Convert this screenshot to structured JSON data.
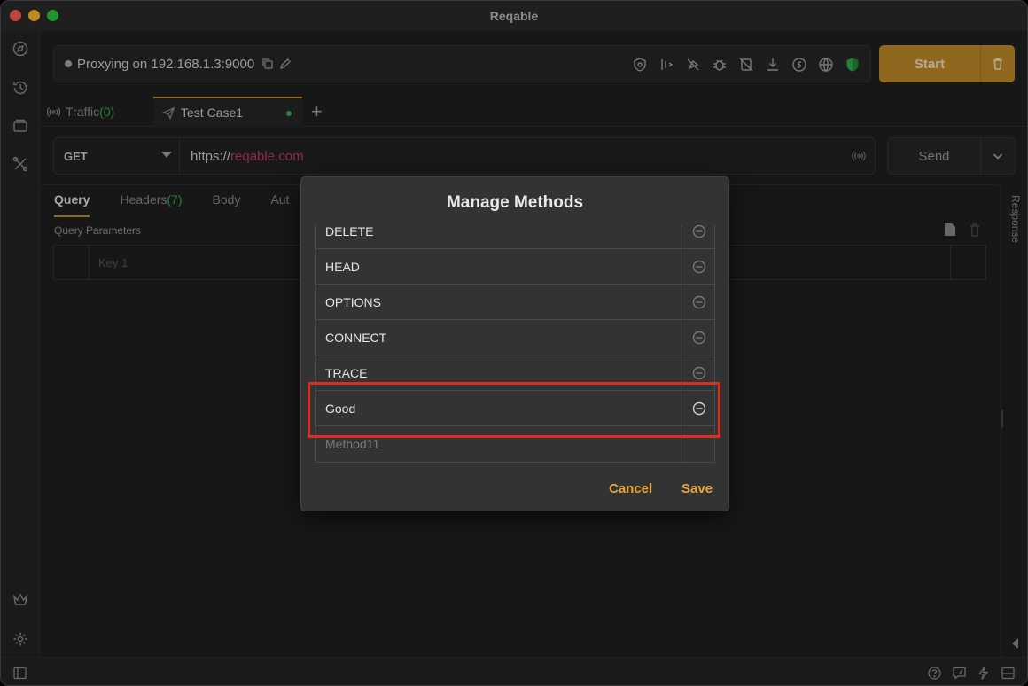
{
  "window": {
    "title": "Reqable"
  },
  "proxy": {
    "status_text": "Proxying on 192.168.1.3:9000"
  },
  "toolbar": {
    "start_label": "Start",
    "tools": [
      "ssl-icon",
      "throttle-icon",
      "breakpoint-off-icon",
      "debug-icon",
      "rewrite-off-icon",
      "download-icon",
      "script-icon",
      "network-icon",
      "shield-icon"
    ]
  },
  "tabs": [
    {
      "label": "Traffic",
      "count": "(0)"
    },
    {
      "label": "Test Case1"
    }
  ],
  "request": {
    "method": "GET",
    "url_scheme": "https://",
    "url_host": "reqable.com",
    "send_label": "Send"
  },
  "subtabs": [
    "Query",
    "Headers",
    "Body",
    "Aut"
  ],
  "headers_count": "(7)",
  "query": {
    "section_label": "Query Parameters",
    "key_placeholder": "Key 1"
  },
  "response_label": "Response",
  "dialog": {
    "title": "Manage Methods",
    "methods": [
      "DELETE",
      "HEAD",
      "OPTIONS",
      "CONNECT",
      "TRACE",
      "Good"
    ],
    "new_placeholder": "Method11",
    "cancel_label": "Cancel",
    "save_label": "Save"
  },
  "colors": {
    "accent": "#c08a2a",
    "action_text": "#e6a53b",
    "highlight": "#d8301f",
    "count": "#36a852",
    "url_host": "#c23a5a"
  }
}
